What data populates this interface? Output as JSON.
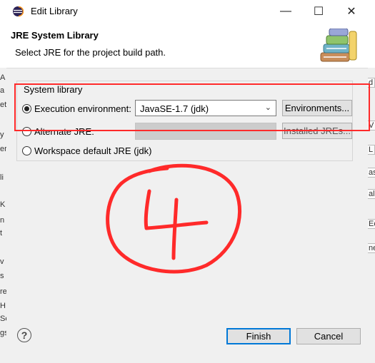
{
  "window": {
    "title": "Edit Library",
    "minimize_glyph": "—",
    "maximize_glyph": "☐",
    "close_glyph": "✕"
  },
  "banner": {
    "title": "JRE System Library",
    "subtitle": "Select JRE for the project build path."
  },
  "group": {
    "label": "System library",
    "options": [
      {
        "label": "Execution environment:",
        "selected": true
      },
      {
        "label": "Alternate JRE:",
        "selected": false
      },
      {
        "label": "Workspace default JRE (jdk)",
        "selected": false
      }
    ],
    "execution_env_value": "JavaSE-1.7 (jdk)",
    "environments_button": "Environments...",
    "installed_jres_button": "Installed JREs..."
  },
  "annotation": {
    "handwritten_text": "4",
    "color": "#ff2a2a"
  },
  "footer": {
    "help_glyph": "?",
    "finish_button": "Finish",
    "cancel_button": "Cancel"
  },
  "background": {
    "left_fragments": [
      "A",
      "a",
      "et",
      "y",
      "er",
      "li",
      "K",
      "n",
      "t",
      "v",
      "s",
      "re",
      "H",
      "Se",
      "gs"
    ],
    "right_fragments": [
      "d",
      "V",
      "L",
      "as",
      "al",
      "Ec",
      "ne"
    ]
  }
}
